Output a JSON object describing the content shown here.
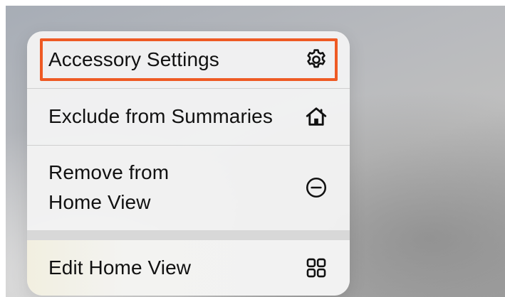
{
  "menu": {
    "items": [
      {
        "label": "Accessory Settings",
        "icon": "gear-icon",
        "highlighted": true
      },
      {
        "label": "Exclude from Summaries",
        "icon": "home-icon"
      },
      {
        "label": "Remove from\nHome View",
        "icon": "minus-circle-icon"
      },
      {
        "label": "Edit Home View",
        "icon": "grid-icon"
      }
    ]
  },
  "colors": {
    "highlight_border": "#ee5a24",
    "menu_bg": "#f2f2f2",
    "text": "#111111"
  }
}
